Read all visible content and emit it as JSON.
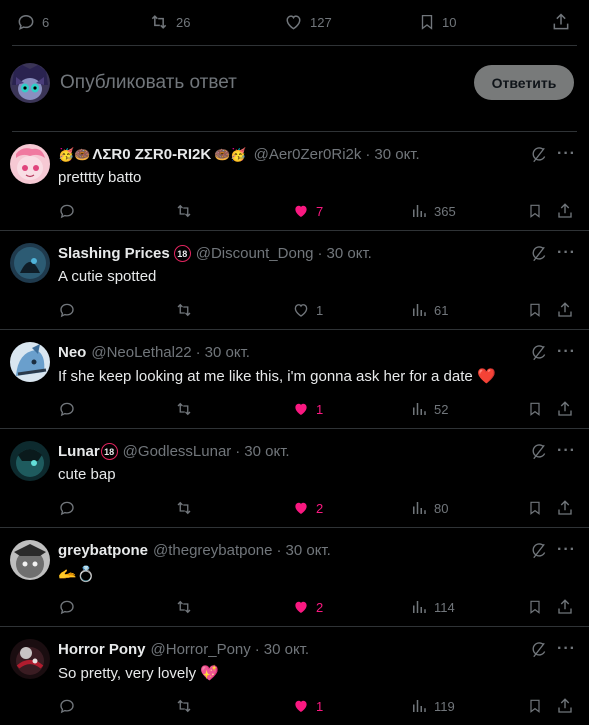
{
  "stats": {
    "replies": "6",
    "reposts": "26",
    "likes": "127",
    "bookmarks": "10"
  },
  "composer": {
    "placeholder": "Опубликовать ответ",
    "reply_label": "Ответить"
  },
  "colors": {
    "background": "#000000",
    "divider": "#2f3336",
    "muted": "#71767b",
    "text": "#e7e9ea",
    "like_active": "#f91880"
  },
  "tweets": [
    {
      "name": "ΛΣR0 ZΣR0-RI2K",
      "name_prefix_emojis": "🥳🍩",
      "name_suffix_emojis": "🍩🥳",
      "handle": "@Aer0Zer0Ri2k",
      "date": "30 окт.",
      "text": "pretttty batto",
      "likes": "7",
      "liked": true,
      "views": "365"
    },
    {
      "name": "Slashing Prices",
      "badge": "18",
      "handle": "@Discount_Dong",
      "date": "30 окт.",
      "text": "A cutie spotted",
      "likes": "1",
      "liked": false,
      "views": "61"
    },
    {
      "name": "Neo",
      "handle": "@NeoLethal22",
      "date": "30 окт.",
      "text": "If she keep looking at me like this, i'm gonna ask her for a date",
      "text_emoji": "❤️",
      "likes": "1",
      "liked": true,
      "views": "52"
    },
    {
      "name": "Lunar",
      "badge": "18",
      "handle": "@GodlessLunar",
      "date": "30 окт.",
      "text": "cute bap",
      "likes": "2",
      "liked": true,
      "views": "80"
    },
    {
      "name": "greybatpone",
      "handle": "@thegreybatpone",
      "date": "30 окт.",
      "text": "",
      "text_emoji": "🫴💍",
      "likes": "2",
      "liked": true,
      "views": "114"
    },
    {
      "name": "Horror Pony",
      "handle": "@Horror_Pony",
      "date": "30 окт.",
      "text": "So pretty, very lovely",
      "text_emoji": "💖",
      "likes": "1",
      "liked": true,
      "views": "119"
    }
  ]
}
